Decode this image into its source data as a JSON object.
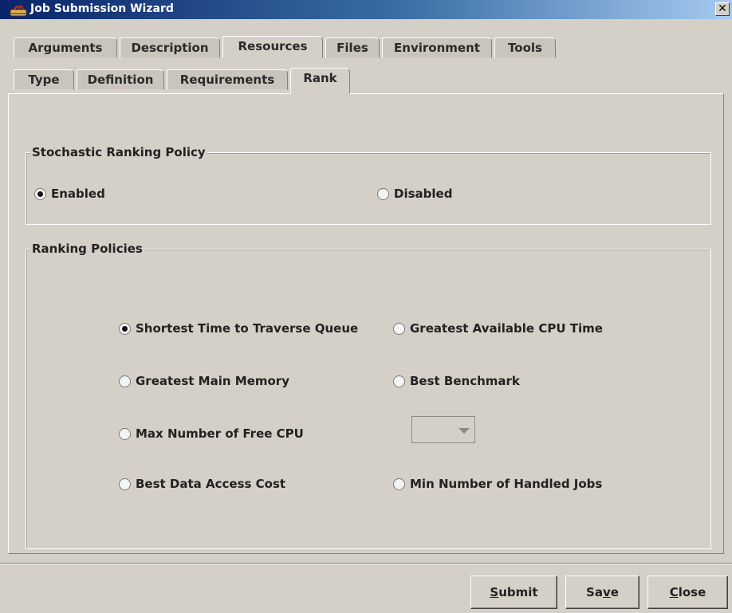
{
  "window": {
    "title": "Job Submission Wizard",
    "close_glyph": "✕",
    "icon": "java-cup-icon"
  },
  "main_tabs": [
    {
      "label": "Arguments",
      "active": false
    },
    {
      "label": "Description",
      "active": false
    },
    {
      "label": "Resources",
      "active": true
    },
    {
      "label": "Files",
      "active": false
    },
    {
      "label": "Environment",
      "active": false
    },
    {
      "label": "Tools",
      "active": false
    }
  ],
  "sub_tabs": [
    {
      "label": "Type",
      "active": false
    },
    {
      "label": "Definition",
      "active": false
    },
    {
      "label": "Requirements",
      "active": false
    },
    {
      "label": "Rank",
      "active": true
    }
  ],
  "stochastic": {
    "title": "Stochastic Ranking Policy",
    "options": [
      {
        "label": "Enabled",
        "checked": true
      },
      {
        "label": "Disabled",
        "checked": false
      }
    ]
  },
  "ranking": {
    "title": "Ranking Policies",
    "options": [
      {
        "label": "Shortest Time to Traverse Queue",
        "checked": true
      },
      {
        "label": "Greatest Available CPU Time",
        "checked": false
      },
      {
        "label": "Greatest Main Memory",
        "checked": false
      },
      {
        "label": "Best Benchmark",
        "checked": false
      },
      {
        "label": "Max Number of Free CPU",
        "checked": false
      },
      {
        "label": "Best Data Access Cost",
        "checked": false
      },
      {
        "label": "Min Number of Handled Jobs",
        "checked": false
      }
    ],
    "cpu_combo_value": ""
  },
  "buttons": {
    "submit": {
      "mnemonic": "S",
      "rest": "ubmit"
    },
    "save": {
      "pre": "Sa",
      "mnemonic": "v",
      "rest": "e"
    },
    "close": {
      "mnemonic": "C",
      "rest": "lose"
    }
  },
  "colors": {
    "title_bar_start": "#0a246a",
    "title_bar_end": "#a6caf0",
    "window_bg": "#d4d0c8"
  }
}
